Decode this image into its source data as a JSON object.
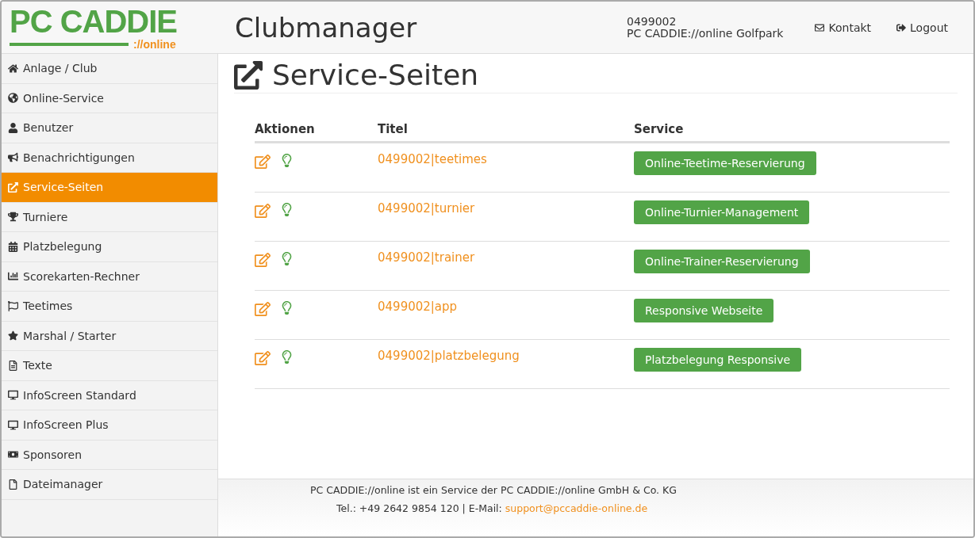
{
  "header": {
    "logo": {
      "brand": "PC CADDIE",
      "suffix": "://online"
    },
    "title": "Clubmanager",
    "account": {
      "id": "0499002",
      "name": "PC CADDIE://online Golfpark"
    },
    "links": [
      "Kontakt",
      "Logout"
    ]
  },
  "sidebar": {
    "items": [
      {
        "label": "Anlage / Club",
        "selected": false
      },
      {
        "label": "Online-Service",
        "selected": false
      },
      {
        "label": "Benutzer",
        "selected": false
      },
      {
        "label": "Benachrichtigungen",
        "selected": false
      },
      {
        "label": "Service-Seiten",
        "selected": true
      },
      {
        "label": "Turniere",
        "selected": false
      },
      {
        "label": "Platzbelegung",
        "selected": false
      },
      {
        "label": "Scorekarten-Rechner",
        "selected": false
      },
      {
        "label": "Teetimes",
        "selected": false
      },
      {
        "label": "Marshal / Starter",
        "selected": false
      },
      {
        "label": "Texte",
        "selected": false
      },
      {
        "label": "InfoScreen Standard",
        "selected": false
      },
      {
        "label": "InfoScreen Plus",
        "selected": false
      },
      {
        "label": "Sponsoren",
        "selected": false
      },
      {
        "label": "Dateimanager",
        "selected": false
      }
    ]
  },
  "page": {
    "title": "Service-Seiten"
  },
  "table": {
    "columns": [
      "Aktionen",
      "Titel",
      "Service"
    ],
    "rows": [
      {
        "title": "0499002|teetimes",
        "service": "Online-Teetime-Reservierung"
      },
      {
        "title": "0499002|turnier",
        "service": "Online-Turnier-Management"
      },
      {
        "title": "0499002|trainer",
        "service": "Online-Trainer-Reservierung"
      },
      {
        "title": "0499002|app",
        "service": "Responsive Webseite"
      },
      {
        "title": "0499002|platzbelegung",
        "service": "Platzbelegung Responsive"
      }
    ]
  },
  "footer": {
    "line1": "PC CADDIE://online ist ein Service der PC CADDIE://online GmbH & Co. KG",
    "line2": "Tel.: +49 2642 9854 120 | E-Mail: ",
    "email": "support@pccaddie-online.de"
  }
}
